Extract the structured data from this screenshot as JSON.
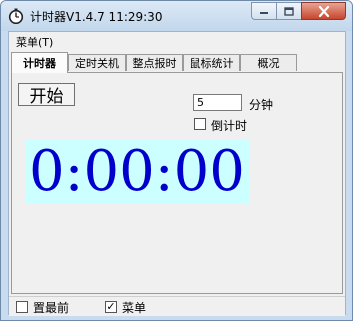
{
  "window": {
    "title": "计时器V1.4.7 11:29:30",
    "controls": {
      "minimize_icon": "minimize-icon",
      "maximize_icon": "maximize-icon",
      "close_icon": "close-icon"
    }
  },
  "menubar": {
    "items": [
      {
        "label": "菜单(T)"
      }
    ]
  },
  "tabs": [
    {
      "label": "计时器",
      "active": true
    },
    {
      "label": "定时关机",
      "active": false
    },
    {
      "label": "整点报时",
      "active": false
    },
    {
      "label": "鼠标统计",
      "active": false
    },
    {
      "label": "概况",
      "active": false
    }
  ],
  "timer": {
    "start_label": "开始",
    "minutes_value": "5",
    "minutes_unit": "分钟",
    "countdown_label": "倒计时",
    "countdown_checked": false,
    "display": "0:00:00",
    "display_bg": "#ccffff",
    "display_color": "#0000cc"
  },
  "statusbar": {
    "pin_label": "置最前",
    "pin_checked": false,
    "menu_label": "菜单",
    "menu_checked": true,
    "check_mark": "✓"
  }
}
